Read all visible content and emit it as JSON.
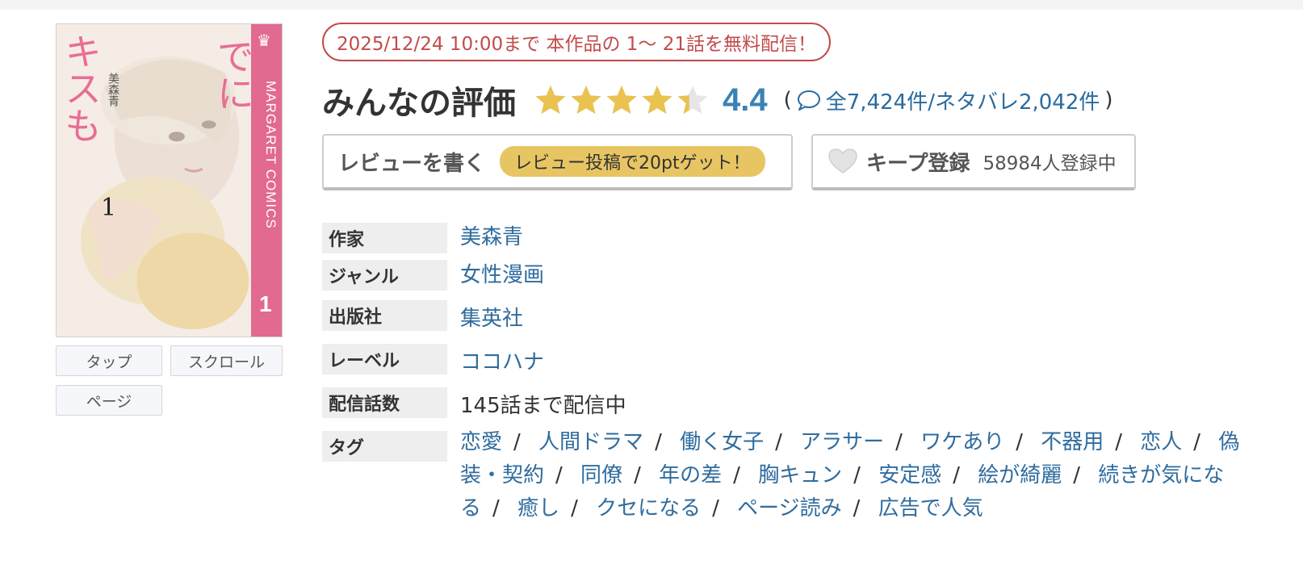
{
  "cover": {
    "title_line1": "抱きしめて ついでに",
    "title_line2": "キスも",
    "author": "美森青",
    "volume": "1",
    "imprint": "MARGARET COMICS",
    "side_volume": "1"
  },
  "viewer_buttons": {
    "tap": "タップ",
    "scroll": "スクロール",
    "page": "ページ"
  },
  "campaign": {
    "text": "2025/12/24 10:00まで 本作品の 1〜 21話を無料配信！"
  },
  "rating": {
    "heading": "みんなの評価",
    "score": "4.4",
    "stars_value": 4.4,
    "stars_max": 5,
    "paren_open": "(",
    "paren_close": ")",
    "reviews": "全7,424件/ネタバレ2,042件"
  },
  "actions": {
    "write_review": "レビューを書く",
    "review_bonus": "レビュー投稿で20ptゲット！",
    "keep": "キープ登録",
    "keep_count": "58984人登録中"
  },
  "info": {
    "author_label": "作家",
    "author": "美森青",
    "genre_label": "ジャンル",
    "genre": "女性漫画",
    "publisher_label": "出版社",
    "publisher": "集英社",
    "label_label": "レーベル",
    "label": "ココハナ",
    "episodes_label": "配信話数",
    "episodes": "145話まで配信中",
    "tags_label": "タグ"
  },
  "tags": [
    "恋愛",
    "人間ドラマ",
    "働く女子",
    "アラサー",
    "ワケあり",
    "不器用",
    "恋人",
    "偽装・契約",
    "同僚",
    "年の差",
    "胸キュン",
    "安定感",
    "絵が綺麗",
    "続きが気になる",
    "癒し",
    "クセになる",
    "ページ読み",
    "広告で人気"
  ],
  "tag_separator": "/",
  "colors": {
    "link": "#2f6c9e",
    "campaign": "#c14b4b",
    "star": "#e9c24f",
    "score": "#3a82b6",
    "cover_band": "#e2698f",
    "pill": "#e8c563"
  }
}
